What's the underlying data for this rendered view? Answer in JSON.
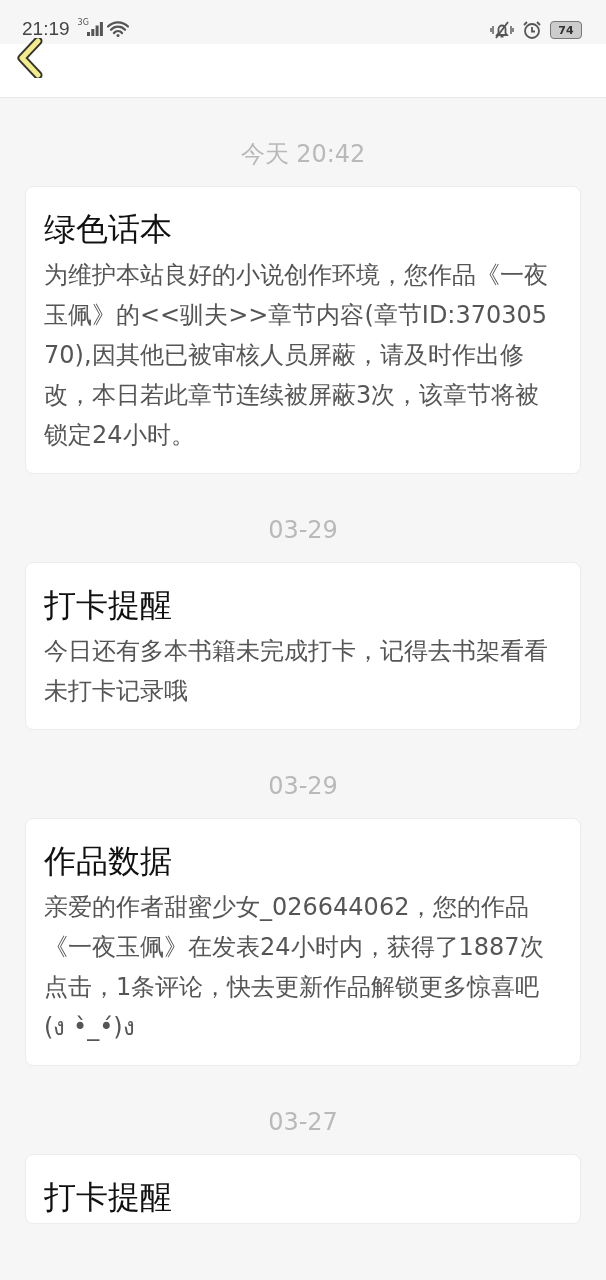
{
  "status_bar": {
    "time": "21:19",
    "network": "3G",
    "battery": "74"
  },
  "messages": [
    {
      "date": "今天 20:42",
      "title": "绿色话本",
      "body": "为维护本站良好的小说创作环境，您作品《一夜玉佩》的<<驯夫>>章节内容(章节ID:37030570),因其他已被审核人员屏蔽，请及时作出修改，本日若此章节连续被屏蔽3次，该章节将被锁定24小时。"
    },
    {
      "date": "03-29",
      "title": "打卡提醒",
      "body": "今日还有多本书籍未完成打卡，记得去书架看看未打卡记录哦"
    },
    {
      "date": "03-29",
      "title": "作品数据",
      "body": "亲爱的作者甜蜜少女_026644062，您的作品《一夜玉佩》在发表24小时内，获得了1887次点击，1条评论，快去更新作品解锁更多惊喜吧(ง •̀_•́)ง"
    },
    {
      "date": "03-27",
      "title": "打卡提醒"
    }
  ]
}
